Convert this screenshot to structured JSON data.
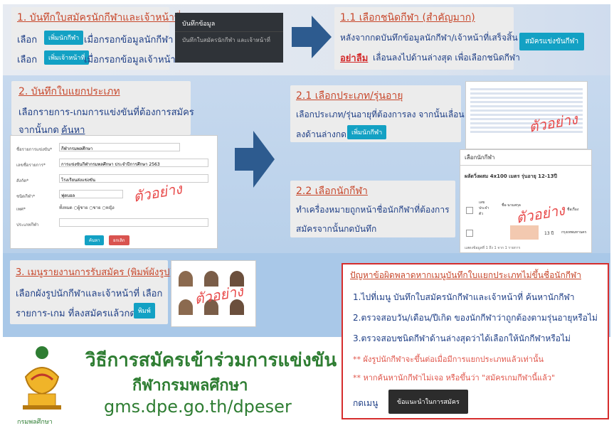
{
  "s1": {
    "title": "1. บันทึกใบสมัครนักกีฬาและเจ้าหน้าที่",
    "line1_pre": "เลือก",
    "btn1": "เพิ่มนักกีฬา",
    "line1_post": "เมื่อกรอกข้อมูลนักกีฬา",
    "line2_pre": "เลือก",
    "btn2": "เพิ่มเจ้าหน้าที่",
    "line2_post": "เมื่อกรอกข้อมูลเจ้าหน้าที่"
  },
  "save_panel": {
    "title": "บันทึกข้อมูล",
    "desc": "บันทึกใบสมัครนักกีฬา และเจ้าหน้าที่"
  },
  "s11": {
    "title": "1.1 เลือกชนิดกีฬา (สำคัญมาก)",
    "line1": "หลังจากกดบันทึกข้อมูลนักกีฬา/เจ้าหน้าที่เสร็จสิ้น",
    "line2_bold": "อย่าลืม",
    "line2": "เลื่อนลงไปด้านล่างสุด เพื่อเลือกชนิดกีฬา",
    "btn": "สมัครแข่งขันกีฬา"
  },
  "s2": {
    "title": "2. บันทึกใบแยกประเภท",
    "line1": "เลือกรายการ-เกมการแข่งขันที่ต้องการสมัคร",
    "line2_pre": "จากนั้นกด",
    "line2_link": "ค้นหา"
  },
  "form": {
    "f1": "ชื่อรายการแข่งขัน*",
    "v1": "กีฬากรมพลศึกษา",
    "f2": "เลขชื่อรายการ*",
    "v2": "การแข่งขันกีฬากรมพลศึกษา ประจำปีการศึกษา 2563",
    "f3": "สังกัด*",
    "v3": "โรงเรียนส่งแข่งขัน",
    "f4": "ชนิดกีฬา*",
    "v4": "ฟุตบอล",
    "f5": "เพศ*",
    "r1": "ทั้งหมด",
    "r2": "ผู้ชาย",
    "r3": "ชาย",
    "r4": "หญิง",
    "f6": "ประเภทกีฬา",
    "search": "ค้นหา",
    "clear": "ยกเลิก"
  },
  "example": "ตัวอย่าง",
  "s21": {
    "title": "2.1 เลือกประเภท/รุ่นอายุ",
    "line1": "เลือกประเภท/รุ่นอายุที่ต้องการลง จากนั้นเลื่อน",
    "line2": "ลงด้านล่างกด",
    "btn": "เพิ่มนักกีฬา"
  },
  "s22": {
    "title": "2.2 เลือกนักกีฬา",
    "line1": "ทำเครื่องหมายถูกหน้าชื่อนักกีฬาที่ต้องการ",
    "line2": "สมัครจากนั้นกดบันทึก"
  },
  "panel22": {
    "header": "เลือกนักกีฬา",
    "sub": "ผลัดวิ่งผสม 4x100 เมตร รุ่นอายุ 12-13ปี",
    "c1": "เลข ประจำ ตัว",
    "c2": "ชื่อ-นามสกุล",
    "c3": "ชื่อเรื่อง",
    "age": "13 ปี",
    "school": "กรุงเทพมหานคร",
    "foot": "แสดงข้อมูลที่ 1 ถึง 1 จาก 1 รายการ"
  },
  "s3": {
    "title": "3. เมนูรายงานการรับสมัคร (พิมพ์ผังรูป)",
    "line1": "เลือกผังรูปนักกีฬาและเจ้าหน้าที่ เลือก",
    "line2": "รายการ-เกม ที่ลงสมัครแล้วกด",
    "btn": "พิมพ์"
  },
  "problem": {
    "title": "ปัญหาข้อผิดพลาดหากเมนูบันทึกใบแยกประเภทไม่ขึ้นชื่อนักกีฬา",
    "i1": "1.ไปที่เมนู บันทึกใบสมัครนักกีฬาและเจ้าหน้าที่ ค้นหานักกีฬา",
    "i2": "2.ตรวจสอบวัน/เดือน/ปีเกิด ของนักกีฬาว่าถูกต้องตามรุ่นอายุหรือไม่",
    "i3": "3.ตรวจสอบชนิดกีฬาด้านล่างสุดว่าได้เลือกให้นักกีฬาหรือไม่",
    "n1": "** ผังรูปนักกีฬาจะขึ้นต่อเมื่อมีการแยกประเภทแล้วเท่านั้น",
    "n2": "** หากค้นหานักกีฬาไม่เจอ หรือขึ้นว่า \"สมัครเกมกีฬานี้แล้ว\"",
    "n3": "กดเมนู",
    "btn": "ข้อแนะนำในการสมัคร"
  },
  "footer": {
    "l1": "วิธีการสมัครเข้าร่วมการแข่งขัน",
    "l2": "กีฬากรมพลศึกษา",
    "l3": "gms.dpe.go.th/dpeser",
    "logo_caption": "กรมพลศึกษา"
  }
}
